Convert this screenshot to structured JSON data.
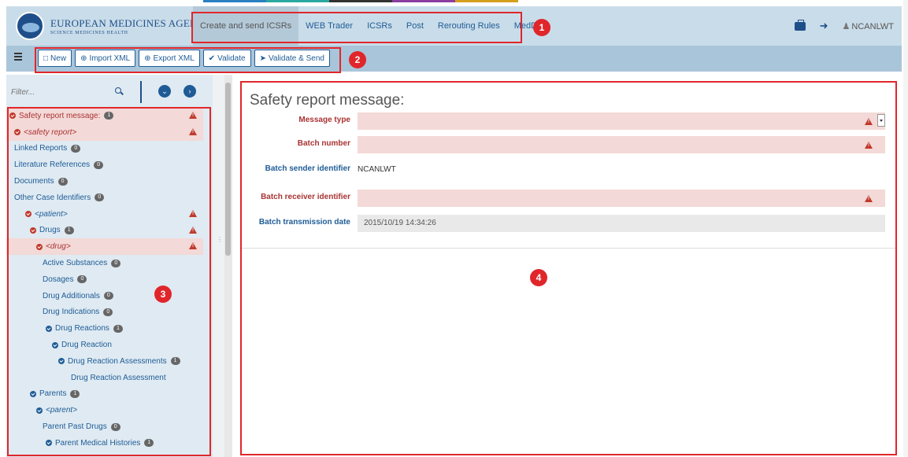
{
  "header": {
    "logo_title": "EUROPEAN MEDICINES AGENCY",
    "logo_subtitle": "SCIENCE   MEDICINES   HEALTH",
    "nav": [
      "Create and send ICSRs",
      "WEB Trader",
      "ICSRs",
      "Post",
      "Rerouting Rules",
      "MedDRA"
    ],
    "username": "NCANLWT"
  },
  "toolbar": {
    "new_label": "New",
    "import_label": "Import XML",
    "export_label": "Export XML",
    "validate_label": "Validate",
    "validate_send_label": "Validate & Send"
  },
  "sidebar": {
    "filter_placeholder": "Filter...",
    "items": [
      {
        "label": "Safety report message:",
        "count": "1",
        "warn": true,
        "state": "err",
        "indent": 0,
        "toggle": true,
        "italic": false
      },
      {
        "label": "<safety report>",
        "count": "",
        "warn": true,
        "state": "err",
        "indent": 1,
        "toggle": true,
        "italic": true
      },
      {
        "label": "Linked Reports",
        "count": "0",
        "warn": false,
        "state": "plain",
        "indent": 1,
        "toggle": false,
        "italic": false
      },
      {
        "label": "Literature References",
        "count": "0",
        "warn": false,
        "state": "plain",
        "indent": 1,
        "toggle": false,
        "italic": false
      },
      {
        "label": "Documents",
        "count": "0",
        "warn": false,
        "state": "plain",
        "indent": 1,
        "toggle": false,
        "italic": false
      },
      {
        "label": "Other Case Identifiers",
        "count": "0",
        "warn": false,
        "state": "plain",
        "indent": 1,
        "toggle": false,
        "italic": false
      },
      {
        "label": "<patient>",
        "count": "",
        "warn": true,
        "state": "plain",
        "indent": 2,
        "toggle": true,
        "italic": true
      },
      {
        "label": "Drugs",
        "count": "1",
        "warn": true,
        "state": "plain",
        "indent": 3,
        "toggle": true,
        "italic": false
      },
      {
        "label": "<drug>",
        "count": "",
        "warn": true,
        "state": "err",
        "indent": 4,
        "toggle": true,
        "italic": true
      },
      {
        "label": "Active Substances",
        "count": "0",
        "warn": false,
        "state": "plain",
        "indent": 5,
        "toggle": false,
        "italic": false
      },
      {
        "label": "Dosages",
        "count": "0",
        "warn": false,
        "state": "plain",
        "indent": 5,
        "toggle": false,
        "italic": false
      },
      {
        "label": "Drug Additionals",
        "count": "0",
        "warn": false,
        "state": "plain",
        "indent": 5,
        "toggle": false,
        "italic": false
      },
      {
        "label": "Drug Indications",
        "count": "0",
        "warn": false,
        "state": "plain",
        "indent": 5,
        "toggle": false,
        "italic": false
      },
      {
        "label": "Drug Reactions",
        "count": "1",
        "warn": false,
        "state": "plain",
        "indent": 6,
        "toggle": true,
        "italic": false
      },
      {
        "label": "Drug Reaction",
        "count": "",
        "warn": false,
        "state": "plain",
        "indent": 7,
        "toggle": true,
        "italic": false
      },
      {
        "label": "Drug Reaction Assessments",
        "count": "1",
        "warn": false,
        "state": "plain",
        "indent": 8,
        "toggle": true,
        "italic": false
      },
      {
        "label": "Drug Reaction Assessment",
        "count": "",
        "warn": false,
        "state": "plain",
        "indent": 9,
        "toggle": false,
        "italic": false
      },
      {
        "label": "Parents",
        "count": "1",
        "warn": false,
        "state": "plain",
        "indent": 3,
        "toggle": true,
        "italic": false
      },
      {
        "label": "<parent>",
        "count": "",
        "warn": false,
        "state": "plain",
        "indent": 4,
        "toggle": true,
        "italic": true
      },
      {
        "label": "Parent Past Drugs",
        "count": "0",
        "warn": false,
        "state": "plain",
        "indent": 5,
        "toggle": false,
        "italic": false
      },
      {
        "label": "Parent Medical Histories",
        "count": "1",
        "warn": false,
        "state": "plain",
        "indent": 6,
        "toggle": true,
        "italic": false
      }
    ]
  },
  "main": {
    "title": "Safety report message:",
    "fields": [
      {
        "label": "Message type",
        "value": "",
        "state": "err",
        "warn": true,
        "dropdown": true
      },
      {
        "label": "Batch number",
        "value": "",
        "state": "err",
        "warn": true,
        "dropdown": false
      },
      {
        "label": "Batch sender identifier",
        "value": "NCANLWT",
        "state": "txt",
        "warn": false,
        "dropdown": false
      },
      {
        "label": "Batch receiver identifier",
        "value": "",
        "state": "err",
        "warn": true,
        "dropdown": false
      },
      {
        "label": "Batch transmission date",
        "value": "2015/10/19 14:34:26",
        "state": "ro",
        "warn": false,
        "dropdown": false
      }
    ]
  },
  "annotations": [
    "1",
    "2",
    "3",
    "4"
  ],
  "colors": {
    "header_bg": "#c9dce9",
    "toolbar_bg": "#a9c5da",
    "accent_blue": "#1f5c96",
    "error_red": "#c0392b",
    "error_bg": "#f3d9d7",
    "annotation_red": "#e0262b"
  }
}
